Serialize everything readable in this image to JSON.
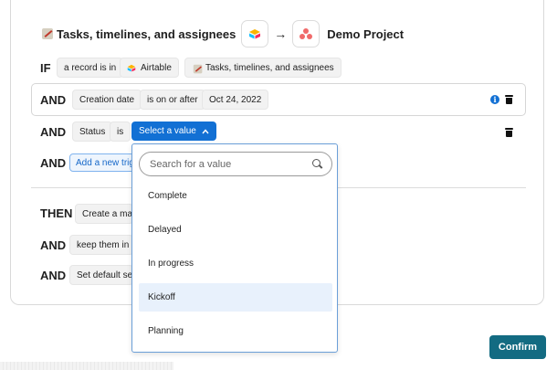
{
  "header": {
    "source_title": "Tasks, timelines, and assignees",
    "arrow": "→",
    "target_title": "Demo Project",
    "source_app_icon": "airtable-icon",
    "target_app_icon": "asana-icon",
    "emoji_icon": "memo-icon"
  },
  "rules": {
    "if_keyword": "IF",
    "if_chips": [
      "a record is in",
      "Airtable",
      "Tasks, timelines, and assignees"
    ],
    "and_keyword": "AND",
    "then_keyword": "THEN",
    "condition1": {
      "field": "Creation date",
      "operator": "is on or after",
      "value": "Oct 24, 2022"
    },
    "condition2": {
      "field": "Status",
      "operator": "is",
      "select_label": "Select a value"
    },
    "add_trigger_label": "Add a new trigg",
    "then_action": "Create a matc",
    "and_action1": "keep them in sy",
    "and_action2": "Set default sect"
  },
  "dropdown": {
    "search_placeholder": "Search for a value",
    "options": [
      "Complete",
      "Delayed",
      "In progress",
      "Kickoff",
      "Planning"
    ],
    "highlighted": "Kickoff"
  },
  "footer": {
    "confirm_label": "Confirm"
  },
  "colors": {
    "accent": "#1270d4",
    "confirm": "#136b82",
    "highlight": "#e8f1fc",
    "asana": "#f06a6a"
  }
}
